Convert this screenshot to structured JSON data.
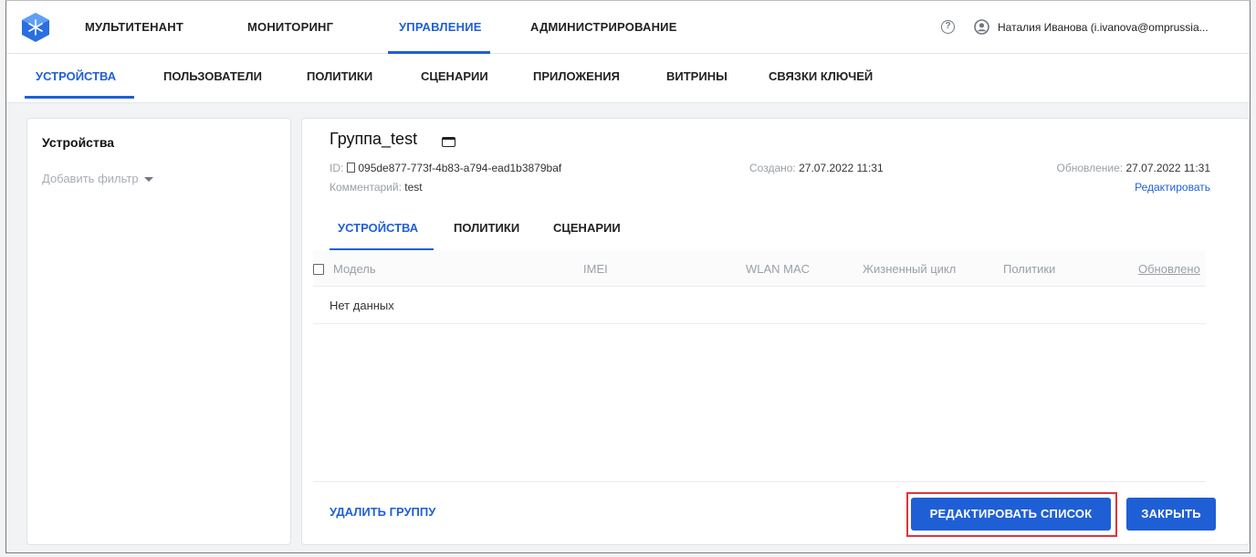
{
  "topnav": {
    "items": [
      {
        "label": "МУЛЬТИТЕНАНТ"
      },
      {
        "label": "МОНИТОРИНГ"
      },
      {
        "label": "УПРАВЛЕНИЕ"
      },
      {
        "label": "АДМИНИСТРИРОВАНИЕ"
      }
    ],
    "active_index": 2,
    "help_icon": "help-circle-icon",
    "user_icon": "account-circle-icon",
    "user_name": "Наталия Иванова (i.ivanova@omprussia..."
  },
  "subnav": {
    "items": [
      {
        "label": "УСТРОЙСТВА"
      },
      {
        "label": "ПОЛЬЗОВАТЕЛИ"
      },
      {
        "label": "ПОЛИТИКИ"
      },
      {
        "label": "СЦЕНАРИИ"
      },
      {
        "label": "ПРИЛОЖЕНИЯ"
      },
      {
        "label": "ВИТРИНЫ"
      },
      {
        "label": "СВЯЗКИ КЛЮЧЕЙ"
      }
    ],
    "active_index": 0
  },
  "left_panel": {
    "title": "Устройства",
    "filter_label": "Добавить фильтр"
  },
  "group": {
    "title": "Группа_test",
    "id_label": "ID:",
    "id_value": "095de877-773f-4b83-a794-ead1b3879baf",
    "comment_label": "Комментарий:",
    "comment_value": "test",
    "created_label": "Создано:",
    "created_value": "27.07.2022 11:31",
    "updated_label": "Обновление:",
    "updated_value": "27.07.2022 11:31",
    "edit_link": "Редактировать"
  },
  "inner_tabs": {
    "items": [
      {
        "label": "УСТРОЙСТВА"
      },
      {
        "label": "ПОЛИТИКИ"
      },
      {
        "label": "СЦЕНАРИИ"
      }
    ],
    "active_index": 0
  },
  "table": {
    "columns": [
      "Модель",
      "IMEI",
      "WLAN MAC",
      "Жизненный цикл",
      "Политики",
      "Обновлено"
    ],
    "sorted_column": "Обновлено",
    "empty_text": "Нет данных"
  },
  "actions": {
    "delete_group": "УДАЛИТЬ ГРУППУ",
    "edit_list": "РЕДАКТИРОВАТЬ СПИСОК",
    "close": "ЗАКРЫТЬ"
  },
  "colors": {
    "accent": "#1f5fd6",
    "highlight": "#e0343a"
  }
}
